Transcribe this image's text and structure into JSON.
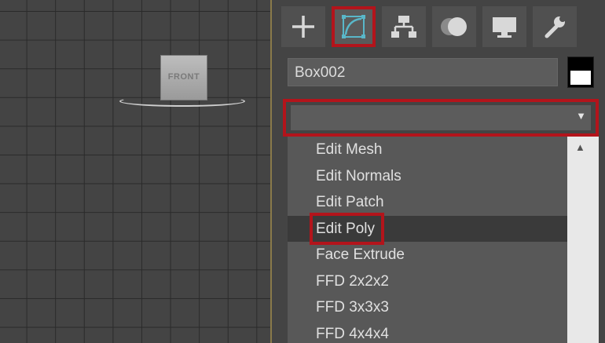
{
  "viewport": {
    "viewcube_label": "FRONT"
  },
  "command_panel": {
    "tabs": [
      {
        "name": "create",
        "icon": "plus-icon"
      },
      {
        "name": "modify",
        "icon": "modify-curve-icon",
        "active": true
      },
      {
        "name": "hierarchy",
        "icon": "hierarchy-icon"
      },
      {
        "name": "motion",
        "icon": "motion-icon"
      },
      {
        "name": "display",
        "icon": "display-monitor-icon"
      },
      {
        "name": "utilities",
        "icon": "wrench-icon"
      }
    ],
    "object_name": "Box002",
    "object_color": "#000000",
    "modifier_list": {
      "selected_value": "",
      "arrow": "▼"
    },
    "list_items": [
      "Edit Mesh",
      "Edit Normals",
      "Edit Patch",
      "Edit Poly",
      "Face Extrude",
      "FFD 2x2x2",
      "FFD 3x3x3",
      "FFD 4x4x4"
    ],
    "selected_item": "Edit Poly",
    "scroll_up_arrow": "▲",
    "highlight_color": "#b3141b"
  }
}
